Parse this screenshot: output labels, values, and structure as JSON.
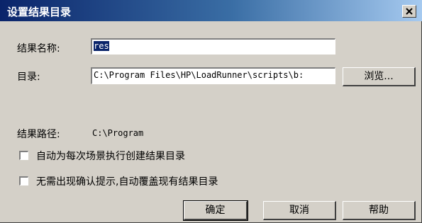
{
  "window": {
    "title": "设置结果目录",
    "close_label": "×"
  },
  "form": {
    "result_name_label": "结果名称:",
    "result_name_value": "res",
    "directory_label": "目录:",
    "directory_value": "C:\\Program Files\\HP\\LoadRunner\\scripts\\b:",
    "browse_button": "浏览...",
    "result_path_label": "结果路径:",
    "result_path_value": "C:\\Program"
  },
  "options": [
    {
      "label": "自动为每次场景执行创建结果目录",
      "checked": false
    },
    {
      "label": "无需出现确认提示,自动覆盖现有结果目录",
      "checked": false
    }
  ],
  "buttons": {
    "ok": "确定",
    "cancel": "取消",
    "help": "帮助"
  }
}
